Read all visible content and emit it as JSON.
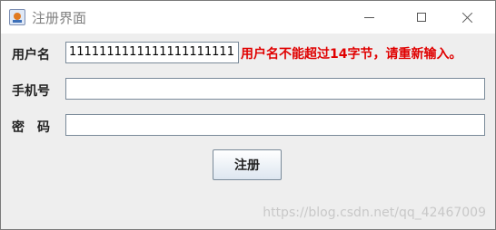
{
  "window": {
    "title": "注册界面"
  },
  "form": {
    "username_label": "用户名",
    "username_value": "1111111111111111111111",
    "username_error": "用户名不能超过14字节，请重新输入。",
    "phone_label": "手机号",
    "phone_value": "",
    "password_label": "密　码",
    "password_value": "",
    "register_label": "注册"
  },
  "watermark": "https://blog.csdn.net/qq_42467009",
  "colors": {
    "error": "#e00000",
    "background": "#eeeeee"
  }
}
